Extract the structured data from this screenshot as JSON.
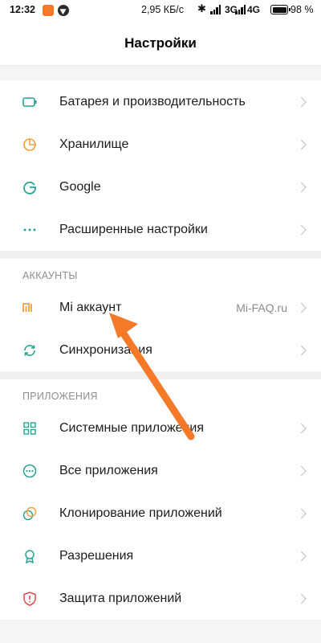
{
  "status_bar": {
    "time": "12:32",
    "speed": "2,95 КБ/с",
    "network1": "3G",
    "network2": "4G",
    "battery": "98 %"
  },
  "header": {
    "title": "Настройки"
  },
  "groups": {
    "top": [
      {
        "label": "Батарея и производительность",
        "icon": "battery-icon"
      },
      {
        "label": "Хранилище",
        "icon": "storage-pie-icon"
      },
      {
        "label": "Google",
        "icon": "google-icon"
      },
      {
        "label": "Расширенные настройки",
        "icon": "more-dots-icon"
      }
    ],
    "accounts": {
      "header": "АККАУНТЫ",
      "items": [
        {
          "label": "Mi аккаунт",
          "value": "Mi-FAQ.ru",
          "icon": "mi-logo-icon"
        },
        {
          "label": "Синхронизация",
          "icon": "sync-icon"
        }
      ]
    },
    "apps": {
      "header": "ПРИЛОЖЕНИЯ",
      "items": [
        {
          "label": "Системные приложения",
          "icon": "grid-apps-icon"
        },
        {
          "label": "Все приложения",
          "icon": "circle-dots-icon"
        },
        {
          "label": "Клонирование приложений",
          "icon": "clone-icon"
        },
        {
          "label": "Разрешения",
          "icon": "badge-icon"
        },
        {
          "label": "Защита приложений",
          "icon": "shield-icon"
        }
      ]
    }
  },
  "colors": {
    "teal": "#27a592",
    "orange": "#f0a040",
    "red": "#e04a4a",
    "arrow": "#f47a2a"
  }
}
